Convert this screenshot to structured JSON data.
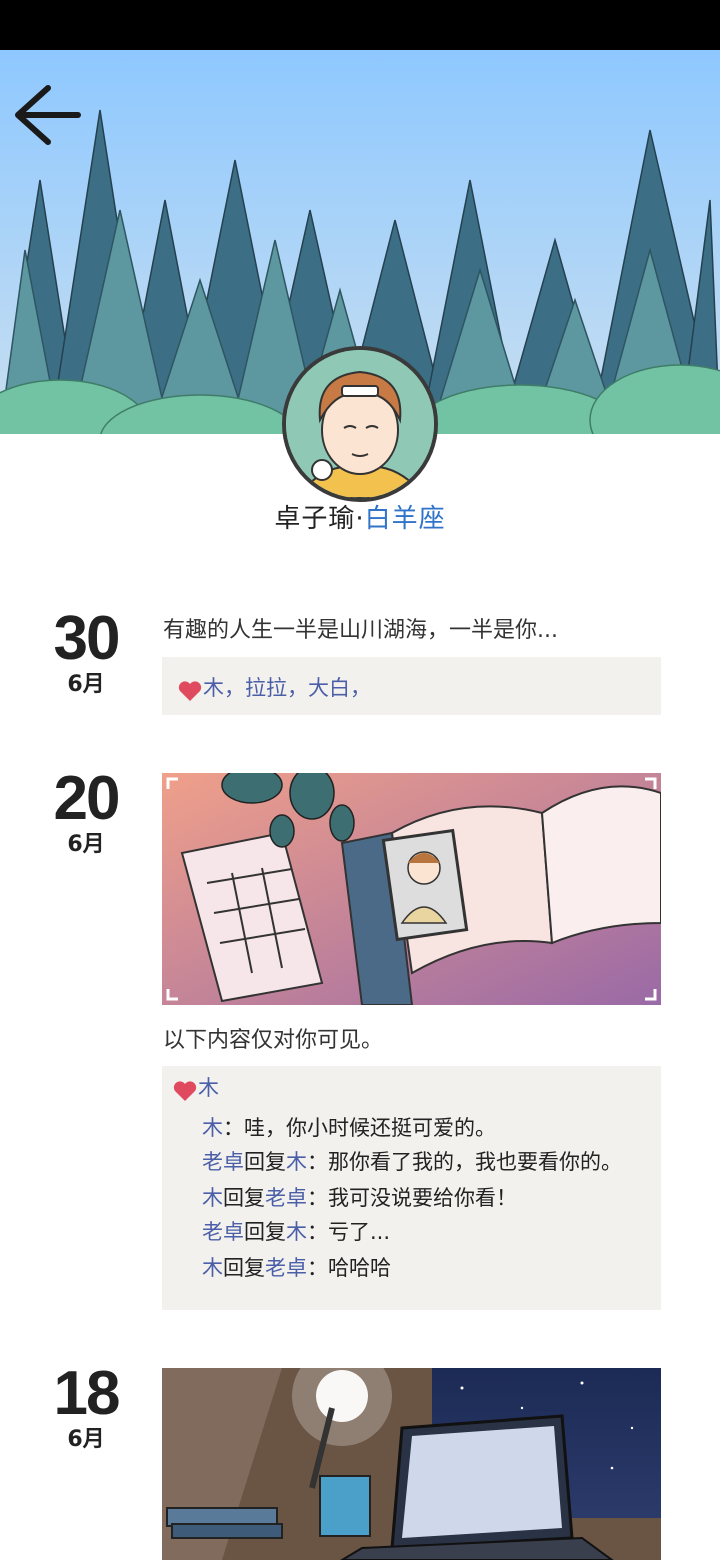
{
  "profile": {
    "name": "卓子瑜",
    "separator": "·",
    "sign": "白羊座"
  },
  "posts": [
    {
      "day": "30",
      "month": "6月",
      "text": "有趣的人生一半是山川湖海，一半是你...",
      "likes": "木，拉拉，大白，"
    },
    {
      "day": "20",
      "month": "6月",
      "text": "以下内容仅对你可见。",
      "likes": "木",
      "comments": [
        {
          "from": "木",
          "reply_word": "",
          "to": "",
          "colon": "：",
          "text": "哇，你小时候还挺可爱的。"
        },
        {
          "from": "老卓",
          "reply_word": "回复",
          "to": "木",
          "colon": "：",
          "text": "那你看了我的，我也要看你的。"
        },
        {
          "from": "木",
          "reply_word": "回复",
          "to": "老卓",
          "colon": "：",
          "text": "我可没说要给你看！"
        },
        {
          "from": "老卓",
          "reply_word": "回复",
          "to": "木",
          "colon": "：",
          "text": "亏了..."
        },
        {
          "from": "木",
          "reply_word": "回复",
          "to": "老卓",
          "colon": "：",
          "text": "哈哈哈"
        }
      ]
    },
    {
      "day": "18",
      "month": "6月"
    }
  ],
  "colors": {
    "accent_blue": "#2f74c9",
    "name_link": "#4a5fa8",
    "like_heart": "#e04a5f",
    "panel_bg": "#f2f1ee"
  },
  "icons": {
    "back": "back-arrow-icon",
    "heart": "heart-icon"
  }
}
